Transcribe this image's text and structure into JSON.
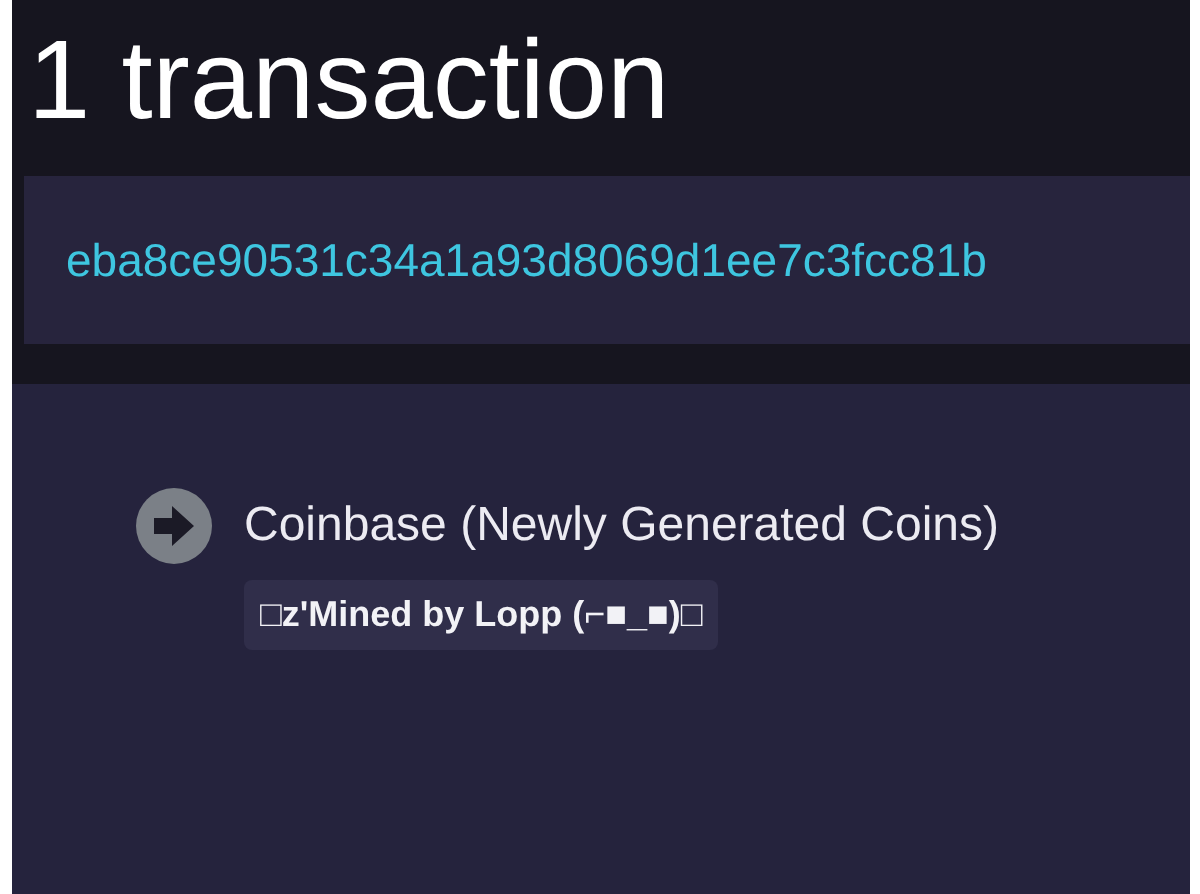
{
  "title": "1 transaction",
  "transaction": {
    "hash": "eba8ce90531c34a1a93d8069d1ee7c3fcc81b",
    "inputs": [
      {
        "kind": "coinbase",
        "label": "Coinbase (Newly Generated Coins)",
        "tag": "□z'Mined by Lopp (⌐■_■)□"
      }
    ]
  }
}
